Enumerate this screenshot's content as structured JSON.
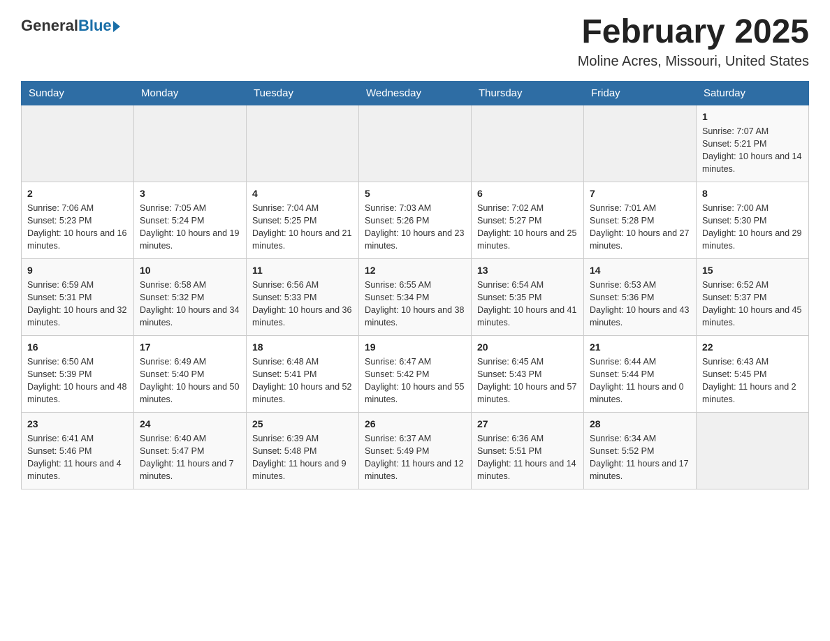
{
  "header": {
    "logo_general": "General",
    "logo_blue": "Blue",
    "month_title": "February 2025",
    "location": "Moline Acres, Missouri, United States"
  },
  "weekdays": [
    "Sunday",
    "Monday",
    "Tuesday",
    "Wednesday",
    "Thursday",
    "Friday",
    "Saturday"
  ],
  "weeks": [
    [
      {
        "day": "",
        "sunrise": "",
        "sunset": "",
        "daylight": ""
      },
      {
        "day": "",
        "sunrise": "",
        "sunset": "",
        "daylight": ""
      },
      {
        "day": "",
        "sunrise": "",
        "sunset": "",
        "daylight": ""
      },
      {
        "day": "",
        "sunrise": "",
        "sunset": "",
        "daylight": ""
      },
      {
        "day": "",
        "sunrise": "",
        "sunset": "",
        "daylight": ""
      },
      {
        "day": "",
        "sunrise": "",
        "sunset": "",
        "daylight": ""
      },
      {
        "day": "1",
        "sunrise": "Sunrise: 7:07 AM",
        "sunset": "Sunset: 5:21 PM",
        "daylight": "Daylight: 10 hours and 14 minutes."
      }
    ],
    [
      {
        "day": "2",
        "sunrise": "Sunrise: 7:06 AM",
        "sunset": "Sunset: 5:23 PM",
        "daylight": "Daylight: 10 hours and 16 minutes."
      },
      {
        "day": "3",
        "sunrise": "Sunrise: 7:05 AM",
        "sunset": "Sunset: 5:24 PM",
        "daylight": "Daylight: 10 hours and 19 minutes."
      },
      {
        "day": "4",
        "sunrise": "Sunrise: 7:04 AM",
        "sunset": "Sunset: 5:25 PM",
        "daylight": "Daylight: 10 hours and 21 minutes."
      },
      {
        "day": "5",
        "sunrise": "Sunrise: 7:03 AM",
        "sunset": "Sunset: 5:26 PM",
        "daylight": "Daylight: 10 hours and 23 minutes."
      },
      {
        "day": "6",
        "sunrise": "Sunrise: 7:02 AM",
        "sunset": "Sunset: 5:27 PM",
        "daylight": "Daylight: 10 hours and 25 minutes."
      },
      {
        "day": "7",
        "sunrise": "Sunrise: 7:01 AM",
        "sunset": "Sunset: 5:28 PM",
        "daylight": "Daylight: 10 hours and 27 minutes."
      },
      {
        "day": "8",
        "sunrise": "Sunrise: 7:00 AM",
        "sunset": "Sunset: 5:30 PM",
        "daylight": "Daylight: 10 hours and 29 minutes."
      }
    ],
    [
      {
        "day": "9",
        "sunrise": "Sunrise: 6:59 AM",
        "sunset": "Sunset: 5:31 PM",
        "daylight": "Daylight: 10 hours and 32 minutes."
      },
      {
        "day": "10",
        "sunrise": "Sunrise: 6:58 AM",
        "sunset": "Sunset: 5:32 PM",
        "daylight": "Daylight: 10 hours and 34 minutes."
      },
      {
        "day": "11",
        "sunrise": "Sunrise: 6:56 AM",
        "sunset": "Sunset: 5:33 PM",
        "daylight": "Daylight: 10 hours and 36 minutes."
      },
      {
        "day": "12",
        "sunrise": "Sunrise: 6:55 AM",
        "sunset": "Sunset: 5:34 PM",
        "daylight": "Daylight: 10 hours and 38 minutes."
      },
      {
        "day": "13",
        "sunrise": "Sunrise: 6:54 AM",
        "sunset": "Sunset: 5:35 PM",
        "daylight": "Daylight: 10 hours and 41 minutes."
      },
      {
        "day": "14",
        "sunrise": "Sunrise: 6:53 AM",
        "sunset": "Sunset: 5:36 PM",
        "daylight": "Daylight: 10 hours and 43 minutes."
      },
      {
        "day": "15",
        "sunrise": "Sunrise: 6:52 AM",
        "sunset": "Sunset: 5:37 PM",
        "daylight": "Daylight: 10 hours and 45 minutes."
      }
    ],
    [
      {
        "day": "16",
        "sunrise": "Sunrise: 6:50 AM",
        "sunset": "Sunset: 5:39 PM",
        "daylight": "Daylight: 10 hours and 48 minutes."
      },
      {
        "day": "17",
        "sunrise": "Sunrise: 6:49 AM",
        "sunset": "Sunset: 5:40 PM",
        "daylight": "Daylight: 10 hours and 50 minutes."
      },
      {
        "day": "18",
        "sunrise": "Sunrise: 6:48 AM",
        "sunset": "Sunset: 5:41 PM",
        "daylight": "Daylight: 10 hours and 52 minutes."
      },
      {
        "day": "19",
        "sunrise": "Sunrise: 6:47 AM",
        "sunset": "Sunset: 5:42 PM",
        "daylight": "Daylight: 10 hours and 55 minutes."
      },
      {
        "day": "20",
        "sunrise": "Sunrise: 6:45 AM",
        "sunset": "Sunset: 5:43 PM",
        "daylight": "Daylight: 10 hours and 57 minutes."
      },
      {
        "day": "21",
        "sunrise": "Sunrise: 6:44 AM",
        "sunset": "Sunset: 5:44 PM",
        "daylight": "Daylight: 11 hours and 0 minutes."
      },
      {
        "day": "22",
        "sunrise": "Sunrise: 6:43 AM",
        "sunset": "Sunset: 5:45 PM",
        "daylight": "Daylight: 11 hours and 2 minutes."
      }
    ],
    [
      {
        "day": "23",
        "sunrise": "Sunrise: 6:41 AM",
        "sunset": "Sunset: 5:46 PM",
        "daylight": "Daylight: 11 hours and 4 minutes."
      },
      {
        "day": "24",
        "sunrise": "Sunrise: 6:40 AM",
        "sunset": "Sunset: 5:47 PM",
        "daylight": "Daylight: 11 hours and 7 minutes."
      },
      {
        "day": "25",
        "sunrise": "Sunrise: 6:39 AM",
        "sunset": "Sunset: 5:48 PM",
        "daylight": "Daylight: 11 hours and 9 minutes."
      },
      {
        "day": "26",
        "sunrise": "Sunrise: 6:37 AM",
        "sunset": "Sunset: 5:49 PM",
        "daylight": "Daylight: 11 hours and 12 minutes."
      },
      {
        "day": "27",
        "sunrise": "Sunrise: 6:36 AM",
        "sunset": "Sunset: 5:51 PM",
        "daylight": "Daylight: 11 hours and 14 minutes."
      },
      {
        "day": "28",
        "sunrise": "Sunrise: 6:34 AM",
        "sunset": "Sunset: 5:52 PM",
        "daylight": "Daylight: 11 hours and 17 minutes."
      },
      {
        "day": "",
        "sunrise": "",
        "sunset": "",
        "daylight": ""
      }
    ]
  ]
}
